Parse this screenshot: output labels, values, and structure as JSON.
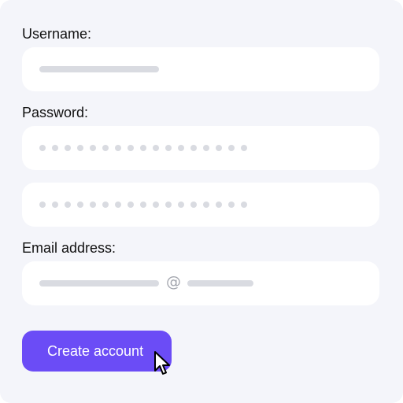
{
  "form": {
    "username": {
      "label": "Username:"
    },
    "password": {
      "label": "Password:",
      "mask_dots": 17,
      "confirm_mask_dots": 17
    },
    "email": {
      "label": "Email address:",
      "at_symbol": "@"
    },
    "submit": {
      "label": "Create account"
    }
  },
  "colors": {
    "background": "#f4f5fa",
    "field": "#ffffff",
    "placeholder": "#d9dbe1",
    "accent": "#6b4cf6",
    "text": "#111111"
  },
  "icons": {
    "pointer": "mouse-pointer-icon"
  }
}
